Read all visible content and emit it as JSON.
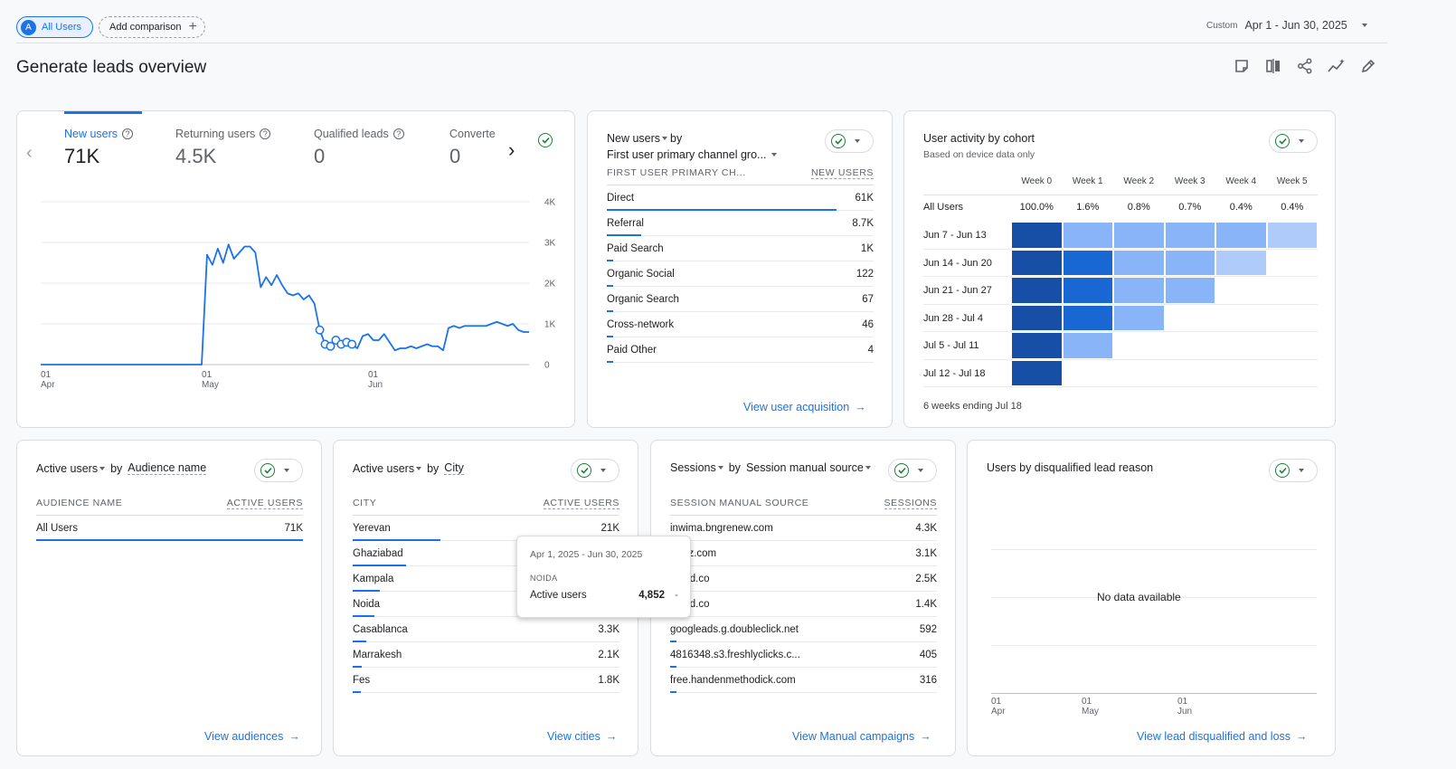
{
  "header": {
    "segment_avatar": "A",
    "segment_label": "All Users",
    "add_comparison_label": "Add comparison",
    "date_prefix": "Custom",
    "date_range": "Apr 1 - Jun 30, 2025",
    "page_title": "Generate leads overview",
    "toolbar_icons": [
      "note-icon",
      "compare-icon",
      "share-icon",
      "insights-icon",
      "edit-icon"
    ]
  },
  "summary_card": {
    "metrics": [
      {
        "label": "New users",
        "value": "71K"
      },
      {
        "label": "Returning users",
        "value": "4.5K"
      },
      {
        "label": "Qualified leads",
        "value": "0"
      },
      {
        "label": "Converte",
        "value": "0"
      }
    ],
    "chart_data": {
      "type": "line",
      "title": "",
      "xlabel": "",
      "ylabel": "",
      "x_ticks": [
        [
          "01",
          "Apr"
        ],
        [
          "01",
          "May"
        ],
        [
          "01",
          "Jun"
        ]
      ],
      "y_ticks": [
        "4K",
        "3K",
        "2K",
        "1K",
        "0"
      ],
      "ylim": [
        0,
        4000
      ],
      "xlim": [
        0,
        91
      ],
      "grid": true,
      "series": [
        {
          "values": [
            [
              0,
              0
            ],
            [
              30,
              0
            ],
            [
              31,
              2700
            ],
            [
              32,
              2450
            ],
            [
              33,
              2850
            ],
            [
              34,
              2500
            ],
            [
              35,
              2950
            ],
            [
              36,
              2600
            ],
            [
              37,
              2750
            ],
            [
              38,
              2900
            ],
            [
              39,
              2900
            ],
            [
              40,
              2750
            ],
            [
              41,
              1900
            ],
            [
              42,
              2150
            ],
            [
              43,
              1950
            ],
            [
              44,
              2200
            ],
            [
              45,
              1950
            ],
            [
              46,
              1750
            ],
            [
              47,
              1700
            ],
            [
              48,
              1750
            ],
            [
              49,
              1600
            ],
            [
              50,
              1700
            ],
            [
              51,
              1500
            ],
            [
              52,
              850
            ],
            [
              53,
              500
            ],
            [
              54,
              450
            ],
            [
              55,
              600
            ],
            [
              56,
              500
            ],
            [
              57,
              550
            ],
            [
              58,
              500
            ],
            [
              59,
              400
            ],
            [
              60,
              700
            ],
            [
              61,
              750
            ],
            [
              62,
              600
            ],
            [
              63,
              600
            ],
            [
              64,
              750
            ],
            [
              65,
              550
            ],
            [
              66,
              350
            ],
            [
              67,
              400
            ],
            [
              68,
              400
            ],
            [
              69,
              450
            ],
            [
              70,
              400
            ],
            [
              71,
              450
            ],
            [
              72,
              500
            ],
            [
              73,
              450
            ],
            [
              74,
              450
            ],
            [
              75,
              350
            ],
            [
              76,
              900
            ],
            [
              77,
              950
            ],
            [
              78,
              900
            ],
            [
              79,
              950
            ],
            [
              80,
              950
            ],
            [
              81,
              950
            ],
            [
              82,
              950
            ],
            [
              83,
              950
            ],
            [
              84,
              1000
            ],
            [
              85,
              1050
            ],
            [
              86,
              1000
            ],
            [
              87,
              950
            ],
            [
              88,
              1000
            ],
            [
              89,
              850
            ],
            [
              90,
              800
            ],
            [
              91,
              800
            ]
          ],
          "anomaly_points": [
            52,
            53,
            54,
            55,
            56,
            57,
            58
          ]
        }
      ]
    }
  },
  "acquisition_card": {
    "title_metric": "New users",
    "title_by": "by",
    "title_dimension": "First user primary channel gro...",
    "col_dimension": "FIRST USER PRIMARY CH...",
    "col_metric": "NEW USERS",
    "rows": [
      {
        "label": "Direct",
        "value": "61K",
        "fraction": 1.0
      },
      {
        "label": "Referral",
        "value": "8.7K",
        "fraction": 0.15
      },
      {
        "label": "Paid Search",
        "value": "1K",
        "fraction": 0.02
      },
      {
        "label": "Organic Social",
        "value": "122",
        "fraction": 0.01
      },
      {
        "label": "Organic Search",
        "value": "67",
        "fraction": 0.005
      },
      {
        "label": "Cross-network",
        "value": "46",
        "fraction": 0.004
      },
      {
        "label": "Paid Other",
        "value": "4",
        "fraction": 0.001
      }
    ],
    "link": "View user acquisition"
  },
  "cohort_card": {
    "title": "User activity by cohort",
    "subtitle": "Based on device data only",
    "weeks": [
      "Week 0",
      "Week 1",
      "Week 2",
      "Week 3",
      "Week 4",
      "Week 5"
    ],
    "all_users_label": "All Users",
    "all_users_values": [
      "100.0%",
      "1.6%",
      "0.8%",
      "0.7%",
      "0.4%",
      "0.4%"
    ],
    "cohorts": [
      {
        "label": "Jun 7 - Jun 13",
        "levels": [
          4,
          2,
          2,
          2,
          2,
          1
        ]
      },
      {
        "label": "Jun 14 - Jun 20",
        "levels": [
          4,
          3,
          2,
          2,
          1
        ]
      },
      {
        "label": "Jun 21 - Jun 27",
        "levels": [
          4,
          3,
          2,
          2
        ]
      },
      {
        "label": "Jun 28 - Jul 4",
        "levels": [
          4,
          3,
          2
        ]
      },
      {
        "label": "Jul 5 - Jul 11",
        "levels": [
          4,
          2
        ]
      },
      {
        "label": "Jul 12 - Jul 18",
        "levels": [
          4
        ]
      }
    ],
    "level_colors": [
      "#ffffff",
      "#aecbfa",
      "#8ab4f8",
      "#1967d2",
      "#174ea6"
    ],
    "footer": "6 weeks ending Jul 18"
  },
  "audience_card": {
    "title_metric": "Active users",
    "title_by": "by",
    "title_dimension": "Audience name",
    "col_dimension": "AUDIENCE NAME",
    "col_metric": "ACTIVE USERS",
    "rows": [
      {
        "label": "All Users",
        "value": "71K",
        "fraction": 1.0
      }
    ],
    "link": "View audiences"
  },
  "city_card": {
    "title_metric": "Active users",
    "title_by": "by",
    "title_dimension": "City",
    "col_dimension": "CITY",
    "col_metric": "ACTIVE USERS",
    "rows": [
      {
        "label": "Yerevan",
        "value": "21K",
        "fraction": 0.33
      },
      {
        "label": "Ghaziabad",
        "value": "",
        "fraction": 0.2
      },
      {
        "label": "Kampala",
        "value": "",
        "fraction": 0.1
      },
      {
        "label": "Noida",
        "value": "",
        "fraction": 0.08
      },
      {
        "label": "Casablanca",
        "value": "3.3K",
        "fraction": 0.05
      },
      {
        "label": "Marrakesh",
        "value": "2.1K",
        "fraction": 0.035
      },
      {
        "label": "Fes",
        "value": "1.8K",
        "fraction": 0.03
      }
    ],
    "link": "View cities",
    "tooltip": {
      "date": "Apr 1, 2025 - Jun 30, 2025",
      "dimension": "NOIDA",
      "metric": "Active users",
      "value": "4,852",
      "change": "-"
    }
  },
  "sessions_card": {
    "title_metric": "Sessions",
    "title_by": "by",
    "title_dimension": "Session manual source",
    "col_dimension": "SESSION MANUAL SOURCE",
    "col_metric": "SESSIONS",
    "rows": [
      {
        "label": "inwima.bngrenew.com",
        "value": "4.3K",
        "fraction": 0.3
      },
      {
        "label": "wpfiz.com",
        "value": "3.1K",
        "fraction": 0.25
      },
      {
        "label": "kated.co",
        "value": "2.5K",
        "fraction": 0.2
      },
      {
        "label": "kated.co",
        "value": "1.4K",
        "fraction": 0.1
      },
      {
        "label": "googleads.g.doubleclick.net",
        "value": "592",
        "fraction": 0.04
      },
      {
        "label": "4816348.s3.freshlyclicks.c...",
        "value": "405",
        "fraction": 0.035
      },
      {
        "label": "free.handenmethodick.com",
        "value": "316",
        "fraction": 0.03
      }
    ],
    "link": "View Manual campaigns"
  },
  "disqualified_card": {
    "title": "Users by disqualified lead reason",
    "empty_text": "No data available",
    "x_ticks": [
      [
        "01",
        "Apr"
      ],
      [
        "01",
        "May"
      ],
      [
        "01",
        "Jun"
      ]
    ],
    "link": "View lead disqualified and loss"
  },
  "colors": {
    "accent": "#1a73e8",
    "check": "#188038"
  }
}
